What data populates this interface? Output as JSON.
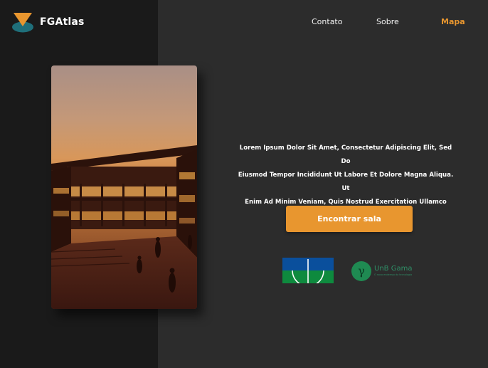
{
  "brand": {
    "name": "FGAtlas",
    "icon": "fgatlas-logo-icon"
  },
  "nav": {
    "contato": "Contato",
    "sobre": "Sobre",
    "mapa": "Mapa"
  },
  "hero": {
    "image": "campus-courtyard-sunset-photo",
    "lines": [
      "Lorem Ipsum Dolor Sit Amet, Consectetur Adipiscing Elit, Sed Do",
      "Eiusmod Tempor Incididunt Ut Labore Et Dolore Magna Aliqua. Ut",
      "Enim Ad Minim Veniam, Quis Nostrud Exercitation Ullamco Labori"
    ],
    "cta_label": "Encontrar sala"
  },
  "partners": {
    "unb_flag": "unb-flag-icon",
    "gama_title": "UnB Gama",
    "gama_subtitle": "O novo endereço da tecnologia"
  },
  "colors": {
    "accent": "#e8962f",
    "left_panel": "#1a1a1a",
    "right_panel": "#2c2c2c",
    "logo_teal": "#1f6f7a"
  }
}
